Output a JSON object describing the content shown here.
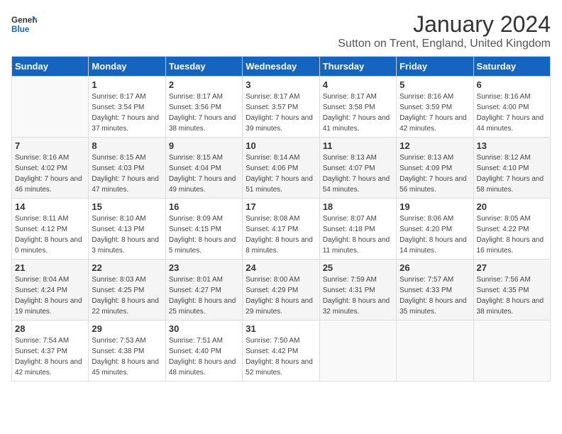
{
  "logo": {
    "general": "General",
    "blue": "Blue"
  },
  "header": {
    "month": "January 2024",
    "location": "Sutton on Trent, England, United Kingdom"
  },
  "weekdays": [
    "Sunday",
    "Monday",
    "Tuesday",
    "Wednesday",
    "Thursday",
    "Friday",
    "Saturday"
  ],
  "weeks": [
    [
      {
        "day": null
      },
      {
        "day": 1,
        "sunrise": "Sunrise: 8:17 AM",
        "sunset": "Sunset: 3:54 PM",
        "daylight": "Daylight: 7 hours and 37 minutes."
      },
      {
        "day": 2,
        "sunrise": "Sunrise: 8:17 AM",
        "sunset": "Sunset: 3:56 PM",
        "daylight": "Daylight: 7 hours and 38 minutes."
      },
      {
        "day": 3,
        "sunrise": "Sunrise: 8:17 AM",
        "sunset": "Sunset: 3:57 PM",
        "daylight": "Daylight: 7 hours and 39 minutes."
      },
      {
        "day": 4,
        "sunrise": "Sunrise: 8:17 AM",
        "sunset": "Sunset: 3:58 PM",
        "daylight": "Daylight: 7 hours and 41 minutes."
      },
      {
        "day": 5,
        "sunrise": "Sunrise: 8:16 AM",
        "sunset": "Sunset: 3:59 PM",
        "daylight": "Daylight: 7 hours and 42 minutes."
      },
      {
        "day": 6,
        "sunrise": "Sunrise: 8:16 AM",
        "sunset": "Sunset: 4:00 PM",
        "daylight": "Daylight: 7 hours and 44 minutes."
      }
    ],
    [
      {
        "day": 7,
        "sunrise": "Sunrise: 8:16 AM",
        "sunset": "Sunset: 4:02 PM",
        "daylight": "Daylight: 7 hours and 46 minutes."
      },
      {
        "day": 8,
        "sunrise": "Sunrise: 8:15 AM",
        "sunset": "Sunset: 4:03 PM",
        "daylight": "Daylight: 7 hours and 47 minutes."
      },
      {
        "day": 9,
        "sunrise": "Sunrise: 8:15 AM",
        "sunset": "Sunset: 4:04 PM",
        "daylight": "Daylight: 7 hours and 49 minutes."
      },
      {
        "day": 10,
        "sunrise": "Sunrise: 8:14 AM",
        "sunset": "Sunset: 4:06 PM",
        "daylight": "Daylight: 7 hours and 51 minutes."
      },
      {
        "day": 11,
        "sunrise": "Sunrise: 8:13 AM",
        "sunset": "Sunset: 4:07 PM",
        "daylight": "Daylight: 7 hours and 54 minutes."
      },
      {
        "day": 12,
        "sunrise": "Sunrise: 8:13 AM",
        "sunset": "Sunset: 4:09 PM",
        "daylight": "Daylight: 7 hours and 56 minutes."
      },
      {
        "day": 13,
        "sunrise": "Sunrise: 8:12 AM",
        "sunset": "Sunset: 4:10 PM",
        "daylight": "Daylight: 7 hours and 58 minutes."
      }
    ],
    [
      {
        "day": 14,
        "sunrise": "Sunrise: 8:11 AM",
        "sunset": "Sunset: 4:12 PM",
        "daylight": "Daylight: 8 hours and 0 minutes."
      },
      {
        "day": 15,
        "sunrise": "Sunrise: 8:10 AM",
        "sunset": "Sunset: 4:13 PM",
        "daylight": "Daylight: 8 hours and 3 minutes."
      },
      {
        "day": 16,
        "sunrise": "Sunrise: 8:09 AM",
        "sunset": "Sunset: 4:15 PM",
        "daylight": "Daylight: 8 hours and 5 minutes."
      },
      {
        "day": 17,
        "sunrise": "Sunrise: 8:08 AM",
        "sunset": "Sunset: 4:17 PM",
        "daylight": "Daylight: 8 hours and 8 minutes."
      },
      {
        "day": 18,
        "sunrise": "Sunrise: 8:07 AM",
        "sunset": "Sunset: 4:18 PM",
        "daylight": "Daylight: 8 hours and 11 minutes."
      },
      {
        "day": 19,
        "sunrise": "Sunrise: 8:06 AM",
        "sunset": "Sunset: 4:20 PM",
        "daylight": "Daylight: 8 hours and 14 minutes."
      },
      {
        "day": 20,
        "sunrise": "Sunrise: 8:05 AM",
        "sunset": "Sunset: 4:22 PM",
        "daylight": "Daylight: 8 hours and 16 minutes."
      }
    ],
    [
      {
        "day": 21,
        "sunrise": "Sunrise: 8:04 AM",
        "sunset": "Sunset: 4:24 PM",
        "daylight": "Daylight: 8 hours and 19 minutes."
      },
      {
        "day": 22,
        "sunrise": "Sunrise: 8:03 AM",
        "sunset": "Sunset: 4:25 PM",
        "daylight": "Daylight: 8 hours and 22 minutes."
      },
      {
        "day": 23,
        "sunrise": "Sunrise: 8:01 AM",
        "sunset": "Sunset: 4:27 PM",
        "daylight": "Daylight: 8 hours and 25 minutes."
      },
      {
        "day": 24,
        "sunrise": "Sunrise: 8:00 AM",
        "sunset": "Sunset: 4:29 PM",
        "daylight": "Daylight: 8 hours and 29 minutes."
      },
      {
        "day": 25,
        "sunrise": "Sunrise: 7:59 AM",
        "sunset": "Sunset: 4:31 PM",
        "daylight": "Daylight: 8 hours and 32 minutes."
      },
      {
        "day": 26,
        "sunrise": "Sunrise: 7:57 AM",
        "sunset": "Sunset: 4:33 PM",
        "daylight": "Daylight: 8 hours and 35 minutes."
      },
      {
        "day": 27,
        "sunrise": "Sunrise: 7:56 AM",
        "sunset": "Sunset: 4:35 PM",
        "daylight": "Daylight: 8 hours and 38 minutes."
      }
    ],
    [
      {
        "day": 28,
        "sunrise": "Sunrise: 7:54 AM",
        "sunset": "Sunset: 4:37 PM",
        "daylight": "Daylight: 8 hours and 42 minutes."
      },
      {
        "day": 29,
        "sunrise": "Sunrise: 7:53 AM",
        "sunset": "Sunset: 4:38 PM",
        "daylight": "Daylight: 8 hours and 45 minutes."
      },
      {
        "day": 30,
        "sunrise": "Sunrise: 7:51 AM",
        "sunset": "Sunset: 4:40 PM",
        "daylight": "Daylight: 8 hours and 48 minutes."
      },
      {
        "day": 31,
        "sunrise": "Sunrise: 7:50 AM",
        "sunset": "Sunset: 4:42 PM",
        "daylight": "Daylight: 8 hours and 52 minutes."
      },
      {
        "day": null
      },
      {
        "day": null
      },
      {
        "day": null
      }
    ]
  ]
}
